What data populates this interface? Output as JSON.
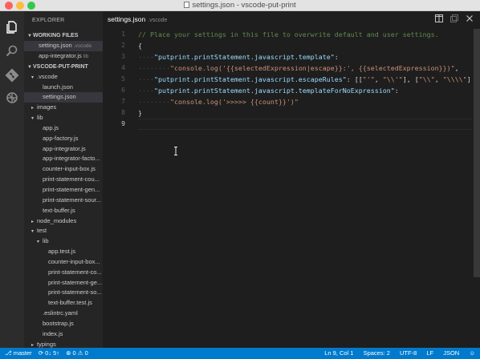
{
  "window": {
    "title": "settings.json - vscode-put-print"
  },
  "explorer": {
    "title": "EXPLORER",
    "working_files": {
      "label": "WORKING FILES",
      "items": [
        {
          "name": "settings.json",
          "desc": ".vscode"
        },
        {
          "name": "app-integrator.js",
          "desc": "lib"
        }
      ]
    },
    "project": {
      "label": "VSCODE-PUT-PRINT",
      "tree": [
        {
          "label": ".vscode",
          "arrow": "▾",
          "depth": 1
        },
        {
          "label": "launch.json",
          "arrow": "",
          "depth": 2
        },
        {
          "label": "settings.json",
          "arrow": "",
          "depth": 2,
          "selected": true
        },
        {
          "label": "images",
          "arrow": "▸",
          "depth": 1
        },
        {
          "label": "lib",
          "arrow": "▾",
          "depth": 1
        },
        {
          "label": "app.js",
          "arrow": "",
          "depth": 2
        },
        {
          "label": "app-factory.js",
          "arrow": "",
          "depth": 2
        },
        {
          "label": "app-integrator.js",
          "arrow": "",
          "depth": 2
        },
        {
          "label": "app-integrator-facto...",
          "arrow": "",
          "depth": 2
        },
        {
          "label": "counter-input-box.js",
          "arrow": "",
          "depth": 2
        },
        {
          "label": "print-statement-cou...",
          "arrow": "",
          "depth": 2
        },
        {
          "label": "print-statement-gen...",
          "arrow": "",
          "depth": 2
        },
        {
          "label": "print-statement-sour...",
          "arrow": "",
          "depth": 2
        },
        {
          "label": "text-buffer.js",
          "arrow": "",
          "depth": 2
        },
        {
          "label": "node_modules",
          "arrow": "▸",
          "depth": 1
        },
        {
          "label": "test",
          "arrow": "▾",
          "depth": 1
        },
        {
          "label": "lib",
          "arrow": "▾",
          "depth": 2
        },
        {
          "label": "app.test.js",
          "arrow": "",
          "depth": 3
        },
        {
          "label": "counter-input-box...",
          "arrow": "",
          "depth": 3
        },
        {
          "label": "print-statement-co...",
          "arrow": "",
          "depth": 3
        },
        {
          "label": "print-statement-ge...",
          "arrow": "",
          "depth": 3
        },
        {
          "label": "print-statement-so...",
          "arrow": "",
          "depth": 3
        },
        {
          "label": "text-buffer.test.js",
          "arrow": "",
          "depth": 3
        },
        {
          "label": ".eslintrc.yaml",
          "arrow": "",
          "depth": 2
        },
        {
          "label": "bootstrap.js",
          "arrow": "",
          "depth": 2
        },
        {
          "label": "index.js",
          "arrow": "",
          "depth": 2
        },
        {
          "label": "typings",
          "arrow": "▸",
          "depth": 1
        }
      ]
    }
  },
  "editor": {
    "tab": {
      "name": "settings.json",
      "desc": ".vscode"
    },
    "active_line": 9,
    "lines": [
      {
        "n": "1",
        "tokens": [
          {
            "t": "// Place your settings in this file to overwrite default and user settings.",
            "c": "comment"
          }
        ]
      },
      {
        "n": "2",
        "tokens": [
          {
            "t": "{",
            "c": "punct"
          }
        ]
      },
      {
        "n": "3",
        "tokens": [
          {
            "t": "····",
            "c": "ws"
          },
          {
            "t": "\"putprint.printStatement.javascript.template\"",
            "c": "key"
          },
          {
            "t": ":",
            "c": "punct"
          }
        ]
      },
      {
        "n": "4",
        "tokens": [
          {
            "t": "········",
            "c": "ws"
          },
          {
            "t": "\"console.log('{{selectedExpression|escape}}:', {{selectedExpression}})\"",
            "c": "string"
          },
          {
            "t": ",",
            "c": "punct"
          }
        ]
      },
      {
        "n": "5",
        "tokens": [
          {
            "t": "····",
            "c": "ws"
          },
          {
            "t": "\"putprint.printStatement.javascript.escapeRules\"",
            "c": "key"
          },
          {
            "t": ": [[",
            "c": "punct"
          },
          {
            "t": "\"'\"",
            "c": "string"
          },
          {
            "t": ", ",
            "c": "punct"
          },
          {
            "t": "\"\\\\'\"",
            "c": "string"
          },
          {
            "t": "], [",
            "c": "punct"
          },
          {
            "t": "\"\\\\\"",
            "c": "string"
          },
          {
            "t": ", ",
            "c": "punct"
          },
          {
            "t": "\"\\\\\\\\\"",
            "c": "string"
          },
          {
            "t": "]],",
            "c": "punct"
          }
        ]
      },
      {
        "n": "6",
        "tokens": [
          {
            "t": "····",
            "c": "ws"
          },
          {
            "t": "\"putprint.printStatement.javascript.templateForNoExpression\"",
            "c": "key"
          },
          {
            "t": ":",
            "c": "punct"
          }
        ]
      },
      {
        "n": "7",
        "tokens": [
          {
            "t": "········",
            "c": "ws"
          },
          {
            "t": "\"console.log('>>>>> {{count}}')\"",
            "c": "string"
          }
        ]
      },
      {
        "n": "8",
        "tokens": [
          {
            "t": "}",
            "c": "punct"
          }
        ]
      },
      {
        "n": "9",
        "tokens": []
      }
    ]
  },
  "statusbar": {
    "branch": "master",
    "sync": "0↓ 5↑",
    "errors": "0",
    "warnings": "0",
    "position": "Ln 9, Col 1",
    "indent": "Spaces: 2",
    "encoding": "UTF-8",
    "eol": "LF",
    "language": "JSON"
  }
}
